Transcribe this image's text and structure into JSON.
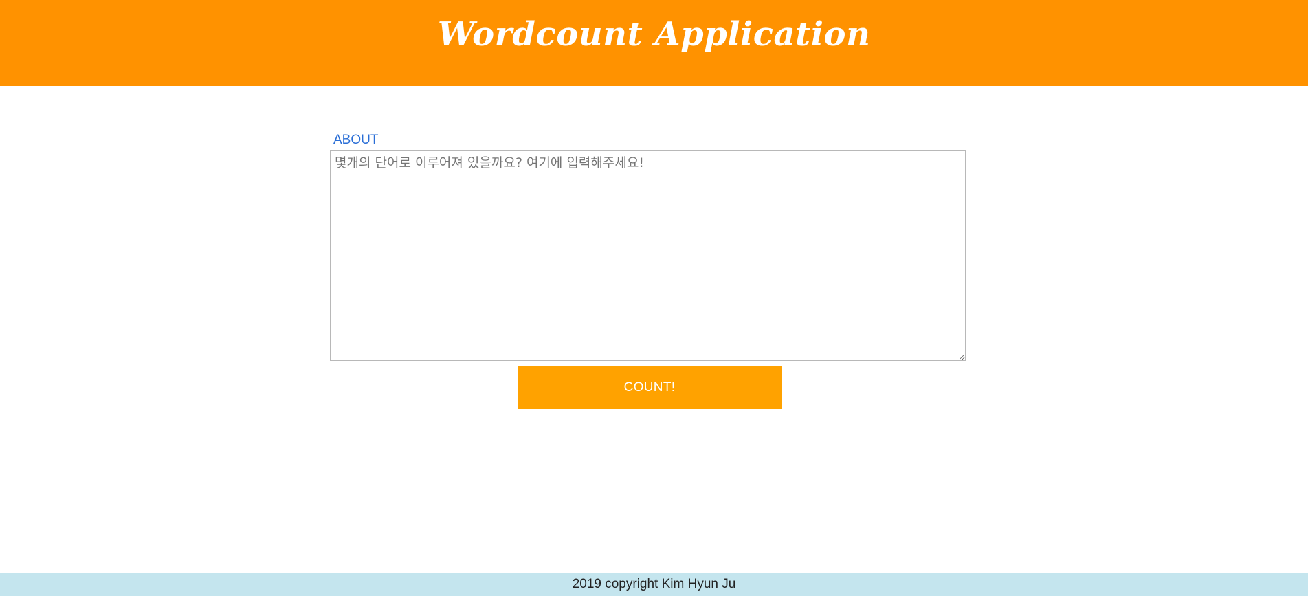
{
  "header": {
    "title": "Wordcount Application"
  },
  "form": {
    "label": "ABOUT",
    "textarea": {
      "value": "",
      "placeholder": "몇개의 단어로 이루어져 있을까요? 여기에 입력해주세요!"
    },
    "count_button_label": "COUNT!"
  },
  "footer": {
    "text": "2019 copyright Kim Hyun Ju"
  },
  "colors": {
    "header_bg": "#ff9200",
    "button_bg": "#ffa200",
    "label_text": "#2a6ed6",
    "footer_bg": "#c4e5ee"
  }
}
